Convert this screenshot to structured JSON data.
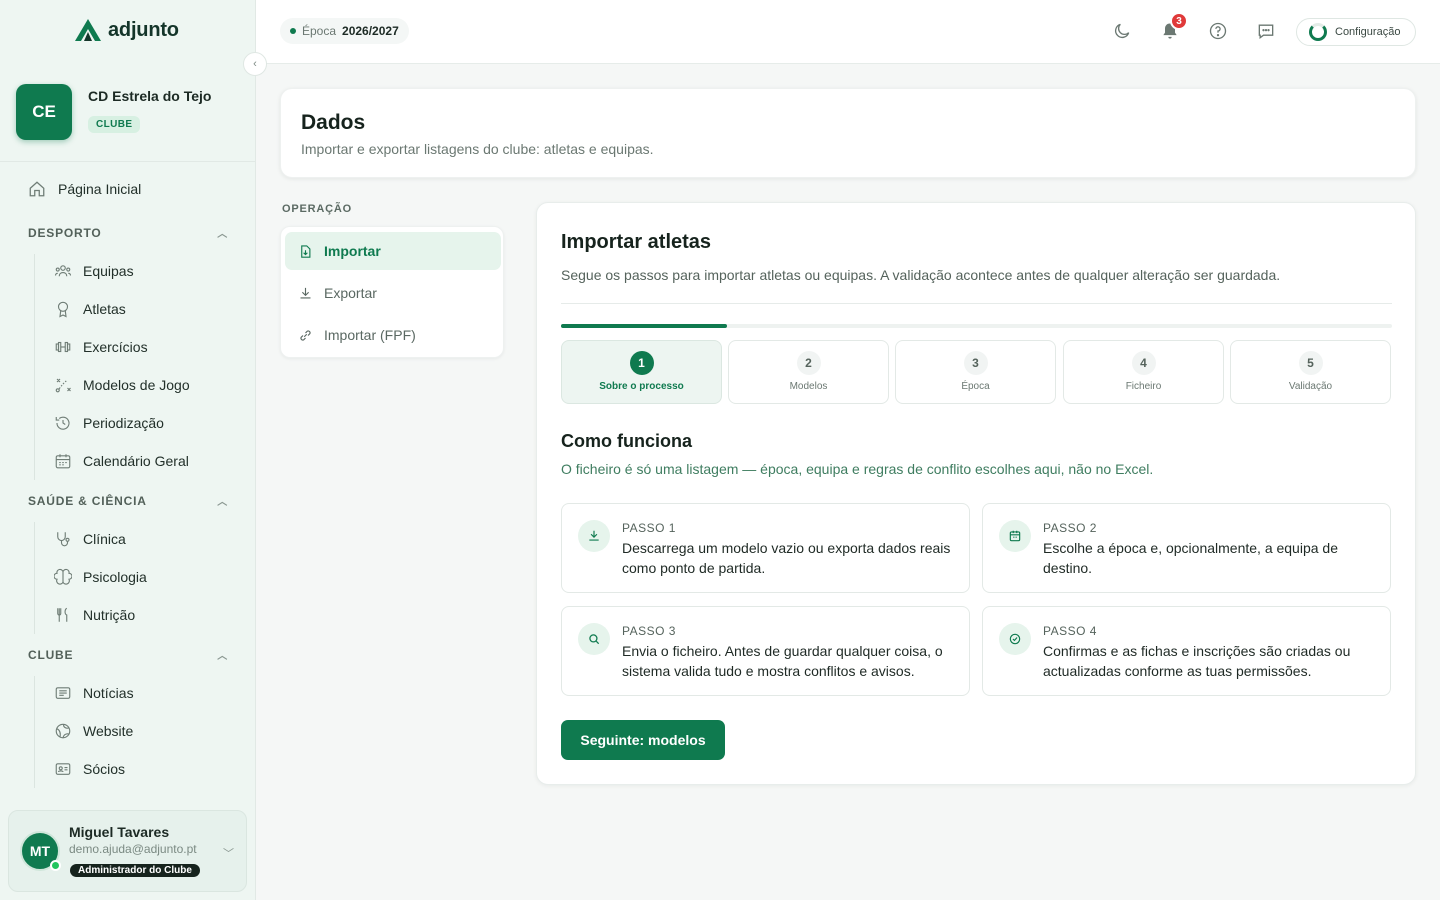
{
  "app": {
    "name": "adjunto"
  },
  "club": {
    "initials": "CE",
    "name": "CD Estrela do Tejo",
    "badge": "CLUBE"
  },
  "sidebar": {
    "home": "Página Inicial",
    "sections": [
      {
        "title": "DESPORTO",
        "items": [
          "Equipas",
          "Atletas",
          "Exercícios",
          "Modelos de Jogo",
          "Periodização",
          "Calendário Geral"
        ]
      },
      {
        "title": "SAÚDE & CIÊNCIA",
        "items": [
          "Clínica",
          "Psicologia",
          "Nutrição"
        ]
      },
      {
        "title": "CLUBE",
        "items": [
          "Notícias",
          "Website",
          "Sócios"
        ]
      }
    ]
  },
  "user": {
    "initials": "MT",
    "name": "Miguel Tavares",
    "email": "demo.ajuda@adjunto.pt",
    "role": "Administrador do Clube"
  },
  "topbar": {
    "season_label": "Época",
    "season_value": "2026/2027",
    "notifications": "3",
    "config_label": "Configuração"
  },
  "header": {
    "title": "Dados",
    "subtitle": "Importar e exportar listagens do clube: atletas e equipas."
  },
  "operation": {
    "label": "OPERAÇÃO",
    "items": [
      "Importar",
      "Exportar",
      "Importar (FPF)"
    ],
    "active": "Importar"
  },
  "import": {
    "title": "Importar atletas",
    "subtitle": "Segue os passos para importar atletas ou equipas. A validação acontece antes de qualquer alteração ser guardada.",
    "progress": 0.2,
    "steps": [
      {
        "num": "1",
        "label": "Sobre o processo"
      },
      {
        "num": "2",
        "label": "Modelos"
      },
      {
        "num": "3",
        "label": "Época"
      },
      {
        "num": "4",
        "label": "Ficheiro"
      },
      {
        "num": "5",
        "label": "Validação"
      }
    ],
    "how_title": "Como funciona",
    "how_subtitle": "O ficheiro é só uma listagem — época, equipa e regras de conflito escolhes aqui, não no Excel.",
    "cards": [
      {
        "label": "PASSO 1",
        "text": "Descarrega um modelo vazio ou exporta dados reais como ponto de partida.",
        "icon": "download-icon"
      },
      {
        "label": "PASSO 2",
        "text": "Escolhe a época e, opcionalmente, a equipa de destino.",
        "icon": "calendar-icon"
      },
      {
        "label": "PASSO 3",
        "text": "Envia o ficheiro. Antes de guardar qualquer coisa, o sistema valida tudo e mostra conflitos e avisos.",
        "icon": "search-icon"
      },
      {
        "label": "PASSO 4",
        "text": "Confirmas e as fichas e inscrições são criadas ou actualizadas conforme as tuas permissões.",
        "icon": "check-circle-icon"
      }
    ],
    "next_button": "Seguinte: modelos"
  },
  "colors": {
    "accent": "#0f7a4f",
    "sidebar_bg": "#eef6f2",
    "badge_red": "#e03a3a"
  }
}
